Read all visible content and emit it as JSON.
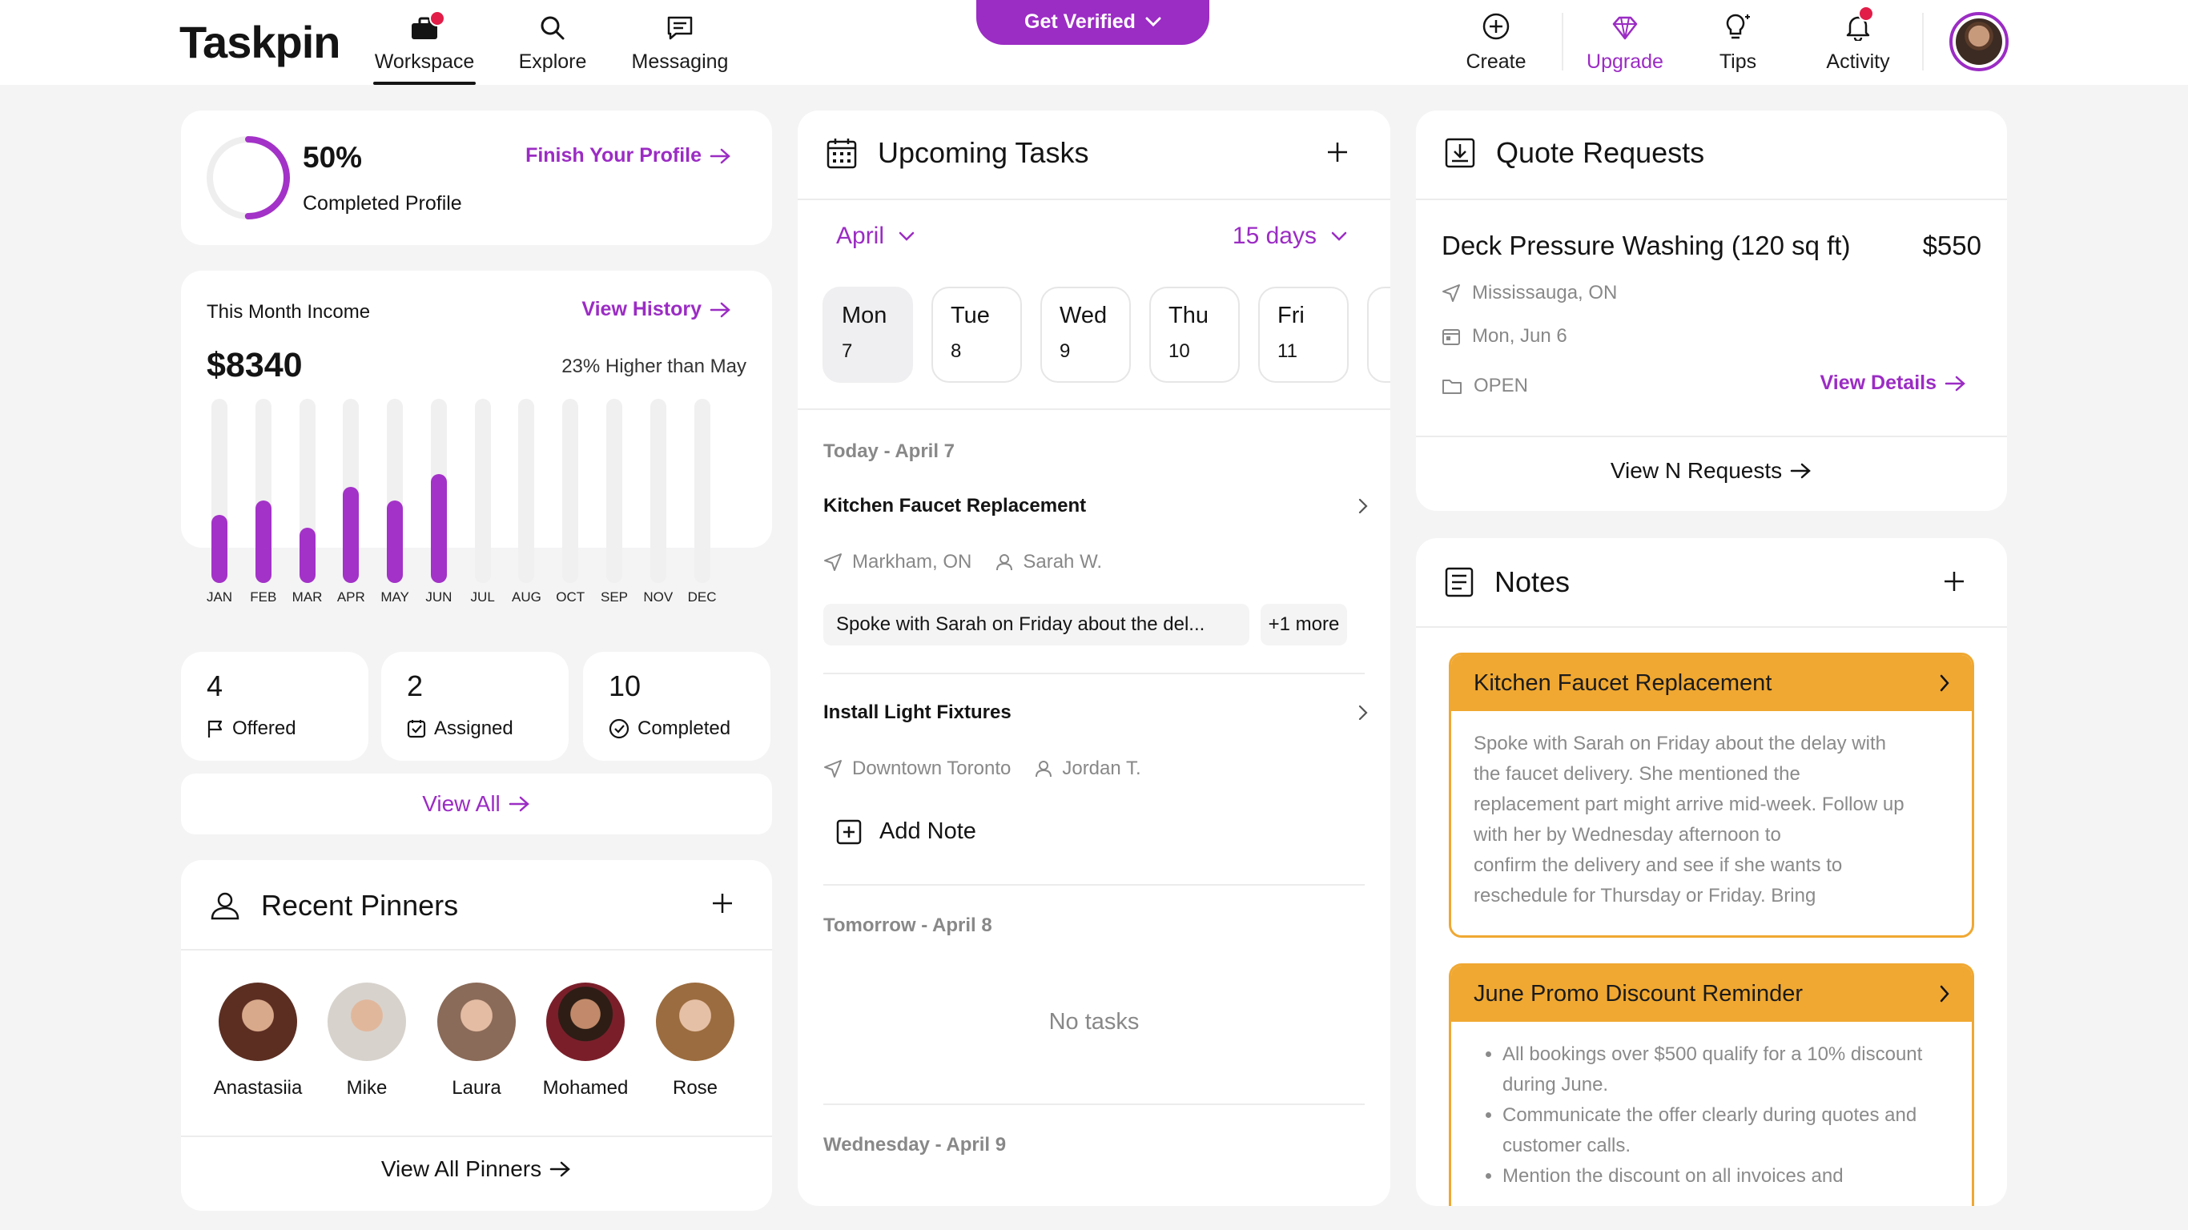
{
  "app": {
    "name": "Taskpin"
  },
  "nav": {
    "workspace": "Workspace",
    "explore": "Explore",
    "messaging": "Messaging",
    "get_verified": "Get Verified",
    "create": "Create",
    "upgrade": "Upgrade",
    "tips": "Tips",
    "activity": "Activity"
  },
  "profile": {
    "percent": "50%",
    "progress": 0.5,
    "label": "Completed Profile",
    "finish_link": "Finish Your Profile"
  },
  "income": {
    "title": "This Month Income",
    "history_link": "View History",
    "amount": "$8340",
    "comparison": "23% Higher than May",
    "chart_data": {
      "type": "bar",
      "categories": [
        "JAN",
        "FEB",
        "MAR",
        "APR",
        "MAY",
        "JUN",
        "JUL",
        "AUG",
        "OCT",
        "SEP",
        "NOV",
        "DEC"
      ],
      "values": [
        0.37,
        0.45,
        0.3,
        0.52,
        0.45,
        0.59,
        0,
        0,
        0,
        0,
        0,
        0
      ],
      "ylim": [
        0,
        1
      ],
      "grid": false,
      "legend": "none"
    }
  },
  "stats": [
    {
      "num": "4",
      "label": "Offered",
      "icon": "flag-icon"
    },
    {
      "num": "2",
      "label": "Assigned",
      "icon": "checkbox-icon"
    },
    {
      "num": "10",
      "label": "Completed",
      "icon": "check-circle-icon"
    }
  ],
  "view_all": "View All",
  "pinners": {
    "title": "Recent Pinners",
    "people": [
      {
        "name": "Anastasiia",
        "color": "#6b3b2b"
      },
      {
        "name": "Mike",
        "color": "#cfc3b8"
      },
      {
        "name": "Laura",
        "color": "#a88470"
      },
      {
        "name": "Mohamed",
        "color": "#5a3a2a"
      },
      {
        "name": "Rose",
        "color": "#8a6a4a"
      }
    ],
    "view_all": "View All Pinners"
  },
  "tasks": {
    "title": "Upcoming Tasks",
    "month": "April",
    "range": "15 days",
    "days": [
      {
        "name": "Mon",
        "date": "7"
      },
      {
        "name": "Tue",
        "date": "8"
      },
      {
        "name": "Wed",
        "date": "9"
      },
      {
        "name": "Thu",
        "date": "10"
      },
      {
        "name": "Fri",
        "date": "11"
      }
    ],
    "today_heading": "Today - April 7",
    "items": [
      {
        "title": "Kitchen Faucet Replacement",
        "location": "Markham, ON",
        "person": "Sarah W.",
        "note": "Spoke with Sarah on Friday about the del...",
        "more": "+1 more"
      },
      {
        "title": "Install Light Fixtures",
        "location": "Downtown Toronto",
        "person": "Jordan T.",
        "add_note": "Add Note"
      }
    ],
    "tomorrow_heading": "Tomorrow - April 8",
    "no_tasks": "No tasks",
    "wednesday_heading": "Wednesday - April 9"
  },
  "quotes": {
    "title": "Quote Requests",
    "item": {
      "title": "Deck Pressure Washing (120 sq ft)",
      "price": "$550",
      "location": "Mississauga, ON",
      "date": "Mon, Jun 6",
      "status": "OPEN",
      "details": "View Details"
    },
    "view_n": "View N Requests"
  },
  "notes": {
    "title": "Notes",
    "items": [
      {
        "title": "Kitchen Faucet Replacement",
        "body": [
          "Spoke with Sarah on Friday about the delay with",
          "the faucet delivery. She mentioned the",
          "replacement part might arrive mid-week. Follow up",
          "with her by Wednesday afternoon to",
          "confirm the delivery and see if she wants to",
          "reschedule for Thursday or Friday. Bring"
        ]
      },
      {
        "title": "June Promo Discount Reminder",
        "bullets": [
          "All bookings over $500 qualify for a 10% discount during June.",
          "Communicate the offer clearly during quotes and customer calls.",
          "Mention the discount on all invoices and"
        ]
      }
    ]
  },
  "colors": {
    "accent": "#9b2cc4",
    "note": "#f0a832",
    "alert": "#e11d48"
  }
}
